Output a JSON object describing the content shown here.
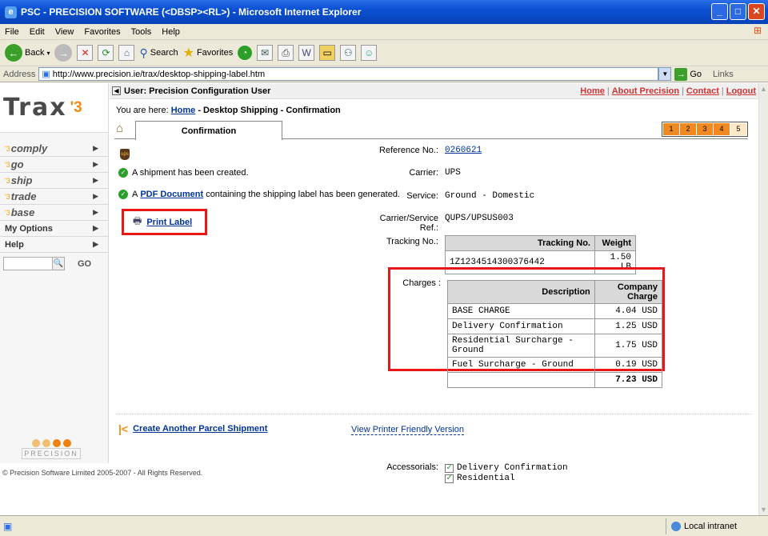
{
  "window": {
    "title": "PSC - PRECISION SOFTWARE (<DBSP><RL>) - Microsoft Internet Explorer"
  },
  "menu": [
    "File",
    "Edit",
    "View",
    "Favorites",
    "Tools",
    "Help"
  ],
  "toolbar": {
    "back": "Back",
    "search": "Search",
    "favorites": "Favorites"
  },
  "address": {
    "label": "Address",
    "url": "http://www.precision.ie/trax/desktop-shipping-label.htm",
    "go": "Go",
    "links": "Links"
  },
  "sidebar": {
    "logo": "Trax",
    "logo_year": "'3",
    "items": [
      {
        "prefix": "'3",
        "label": "comply"
      },
      {
        "prefix": "'3",
        "label": "go"
      },
      {
        "prefix": "'3",
        "label": "ship"
      },
      {
        "prefix": "'3",
        "label": "trade"
      },
      {
        "prefix": "'3",
        "label": "base"
      }
    ],
    "my_options": "My Options",
    "help": "Help",
    "search_go": "GO",
    "precision": "PRECISION"
  },
  "user": {
    "label": "User: Precision Configuration User"
  },
  "toplinks": {
    "home": "Home",
    "about": "About Precision",
    "contact": "Contact",
    "logout": "Logout"
  },
  "breadcrumb": {
    "prefix": "You are here:",
    "home": "Home",
    "rest": " - Desktop Shipping - Confirmation"
  },
  "tab": {
    "label": "Confirmation"
  },
  "steps": [
    "1",
    "2",
    "3",
    "4",
    "5"
  ],
  "messages": {
    "created": "A shipment has been created.",
    "pdf_prefix": "A",
    "pdf_link": "PDF Document",
    "pdf_suffix": "containing the shipping label has been generated.",
    "print_label": "Print Label"
  },
  "ups_icon": "ups",
  "details": {
    "reference_label": "Reference No.:",
    "reference": "0260621",
    "carrier_label": "Carrier:",
    "carrier": "UPS",
    "service_label": "Service:",
    "service": "Ground - Domestic",
    "csref_label": "Carrier/Service Ref.:",
    "csref": "QUPS/UPSUS003",
    "tracking_label": "Tracking No.:",
    "tracking_headers": [
      "Tracking No.",
      "Weight"
    ],
    "tracking_row": [
      "1Z1234514300376442",
      "1.50 LB"
    ],
    "charges_label": "Charges :",
    "charges_headers": [
      "Description",
      "Company Charge"
    ],
    "charges": [
      {
        "desc": "BASE CHARGE",
        "amount": "4.04 USD"
      },
      {
        "desc": "Delivery Confirmation",
        "amount": "1.25 USD"
      },
      {
        "desc": "Residential Surcharge - Ground",
        "amount": "1.75 USD"
      },
      {
        "desc": "Fuel Surcharge - Ground",
        "amount": "0.19 USD"
      }
    ],
    "total": "7.23 USD",
    "accessorials_label": "Accessorials:",
    "accessorials": [
      "Delivery Confirmation",
      "Residential"
    ]
  },
  "footer": {
    "create": "Create Another Parcel Shipment",
    "printer_friendly": "View Printer Friendly Version",
    "copyright": "© Precision Software Limited 2005-2007 - All Rights Reserved."
  },
  "status": {
    "zone": "Local intranet"
  }
}
